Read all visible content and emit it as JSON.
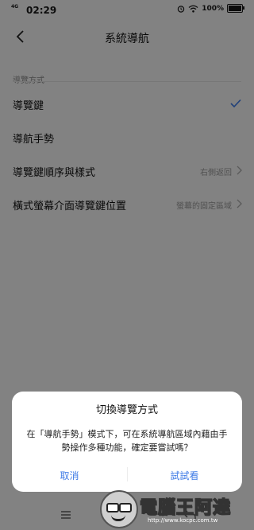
{
  "status_bar": {
    "network": "4G",
    "time": "02:29",
    "battery_percent": "100%"
  },
  "header": {
    "title": "系統導航"
  },
  "section": {
    "label": "導覽方式"
  },
  "rows": [
    {
      "label": "導覽鍵",
      "value": "",
      "selected": true
    },
    {
      "label": "導航手勢",
      "value": "",
      "selected": false
    },
    {
      "label": "導覽鍵順序與樣式",
      "value": "右側返回"
    },
    {
      "label": "橫式螢幕介面導覽鍵位置",
      "value": "螢幕的固定區域"
    }
  ],
  "dialog": {
    "title": "切換導覽方式",
    "message": "在「導航手勢」模式下，可在系統導航區域內藉由手勢操作多種功能，確定要嘗試嗎？",
    "cancel_label": "取消",
    "confirm_label": "試試看"
  },
  "watermark": {
    "text": "電腦王阿達",
    "url": "http://www.kocpc.com.tw"
  },
  "colors": {
    "accent": "#3f7be6",
    "background": "#f5f5f5"
  }
}
